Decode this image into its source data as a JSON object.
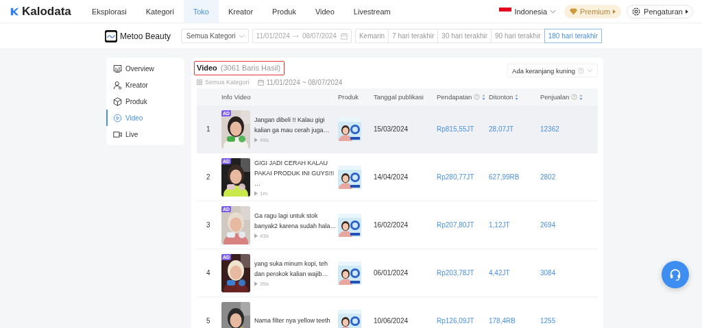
{
  "nav": {
    "brand": "Kalodata",
    "items": [
      {
        "label": "Eksplorasi",
        "selected": false
      },
      {
        "label": "Kategori",
        "selected": false
      },
      {
        "label": "Toko",
        "selected": true
      },
      {
        "label": "Kreator",
        "selected": false
      },
      {
        "label": "Produk",
        "selected": false
      },
      {
        "label": "Video",
        "selected": false
      },
      {
        "label": "Livestream",
        "selected": false
      }
    ],
    "country": "Indonesia",
    "premium": "Premium",
    "settings": "Pengaturan"
  },
  "shop": {
    "name": "Metoo Beauty",
    "category": "Semua Kategori",
    "date_start": "11/01/2024",
    "date_end": "08/07/2024",
    "ranges": [
      {
        "label": "Kemarin",
        "selected": false
      },
      {
        "label": "7 hari terakhir",
        "selected": false
      },
      {
        "label": "30 hari terakhir",
        "selected": false
      },
      {
        "label": "90 hari terakhir",
        "selected": false
      },
      {
        "label": "180 hari terakhir",
        "selected": true
      }
    ]
  },
  "sidebar": {
    "items": [
      {
        "label": "Overview",
        "selected": false
      },
      {
        "label": "Kreator",
        "selected": false
      },
      {
        "label": "Produk",
        "selected": false
      },
      {
        "label": "Video",
        "selected": true
      },
      {
        "label": "Live",
        "selected": false
      }
    ]
  },
  "panel": {
    "title": "Video",
    "count": "(3061 Baris Hasil)",
    "outlined": true,
    "filter": "Ada keranjang kuning",
    "category_chip": "Semua Kategori",
    "date_chip": "11/01/2024 ~ 08/07/2024",
    "columns": [
      {
        "label": "Info Video",
        "help": false,
        "sortable": false
      },
      {
        "label": "Produk",
        "help": false,
        "sortable": false
      },
      {
        "label": "Tanggal publikasi",
        "help": false,
        "sortable": false
      },
      {
        "label": "Pendapatan",
        "help": true,
        "sortable": true
      },
      {
        "label": "Ditonton",
        "help": false,
        "sortable": true
      },
      {
        "label": "Penjualan",
        "help": true,
        "sortable": true
      }
    ],
    "rows": [
      {
        "rank": "1",
        "badge": "AD",
        "title": "Jangan dibeli !! Kalau gigi kalian ga mau cerah juga…",
        "duration": "49s",
        "date": "15/03/2024",
        "revenue": "Rp815,55JT",
        "views": "28,07JT",
        "sales": "12362",
        "hovered": true
      },
      {
        "rank": "2",
        "badge": "AD",
        "title": "GIGI JADI CERAH KALAU PAKAI PRODUK INI GUYS!!! …",
        "duration": "1m",
        "date": "14/04/2024",
        "revenue": "Rp280,77JT",
        "views": "627,99RB",
        "sales": "2802",
        "hovered": false
      },
      {
        "rank": "3",
        "badge": "AD",
        "title": "Ga ragu lagi untuk stok banyak2 karena sudah hala…",
        "duration": "43s",
        "date": "16/02/2024",
        "revenue": "Rp207,80JT",
        "views": "1,12JT",
        "sales": "2694",
        "hovered": false
      },
      {
        "rank": "4",
        "badge": "AD",
        "title": "yang suka minum kopi, teh dan perokok kalian wajib…",
        "duration": "39s",
        "date": "06/01/2024",
        "revenue": "Rp203,78JT",
        "views": "4,42JT",
        "sales": "3084",
        "hovered": false
      },
      {
        "rank": "5",
        "title": "Nama filter nya yellow teeth",
        "date": "10/06/2024",
        "revenue": "Rp126,09JT",
        "views": "178,4RB",
        "sales": "1255",
        "hovered": false
      }
    ]
  }
}
